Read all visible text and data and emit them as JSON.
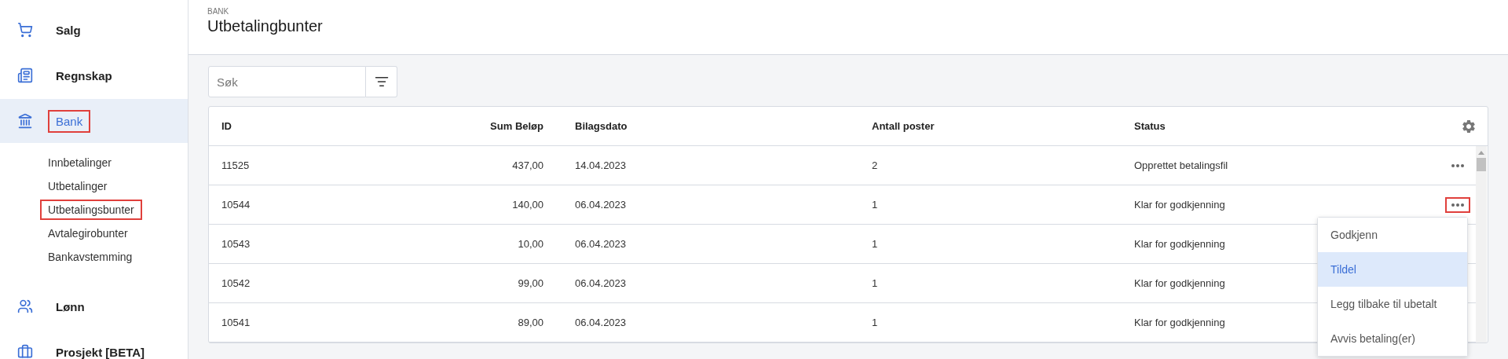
{
  "sidebar": {
    "items": [
      {
        "label": "Salg",
        "selected": false
      },
      {
        "label": "Regnskap",
        "selected": false
      },
      {
        "label": "Bank",
        "selected": true,
        "marked": true,
        "children": [
          {
            "label": "Innbetalinger",
            "marked": false
          },
          {
            "label": "Utbetalinger",
            "marked": false
          },
          {
            "label": "Utbetalingsbunter",
            "marked": true
          },
          {
            "label": "Avtalegirobunter",
            "marked": false
          },
          {
            "label": "Bankavstemming",
            "marked": false
          }
        ]
      },
      {
        "label": "Lønn",
        "selected": false
      },
      {
        "label": "Prosjekt [BETA]",
        "selected": false
      }
    ]
  },
  "header": {
    "breadcrumb": "BANK",
    "title": "Utbetalingbunter"
  },
  "search": {
    "placeholder": "Søk"
  },
  "table": {
    "columns": [
      "ID",
      "Sum Beløp",
      "Bilagsdato",
      "Antall poster",
      "Status"
    ],
    "rows": [
      {
        "cells": [
          "11525",
          "437,00",
          "14.04.2023",
          "2",
          "Opprettet betalingsfil"
        ],
        "action_marked": false
      },
      {
        "cells": [
          "10544",
          "140,00",
          "06.04.2023",
          "1",
          "Klar for godkjenning"
        ],
        "action_marked": true
      },
      {
        "cells": [
          "10543",
          "10,00",
          "06.04.2023",
          "1",
          "Klar for godkjenning"
        ]
      },
      {
        "cells": [
          "10542",
          "99,00",
          "06.04.2023",
          "1",
          "Klar for godkjenning"
        ]
      },
      {
        "cells": [
          "10541",
          "89,00",
          "06.04.2023",
          "1",
          "Klar for godkjenning"
        ]
      }
    ]
  },
  "context_menu": {
    "items": [
      {
        "label": "Godkjenn",
        "selected": false
      },
      {
        "label": "Tildel",
        "selected": true
      },
      {
        "label": "Legg tilbake til ubetalt",
        "selected": false
      },
      {
        "label": "Avvis betaling(er)",
        "selected": false
      }
    ]
  }
}
